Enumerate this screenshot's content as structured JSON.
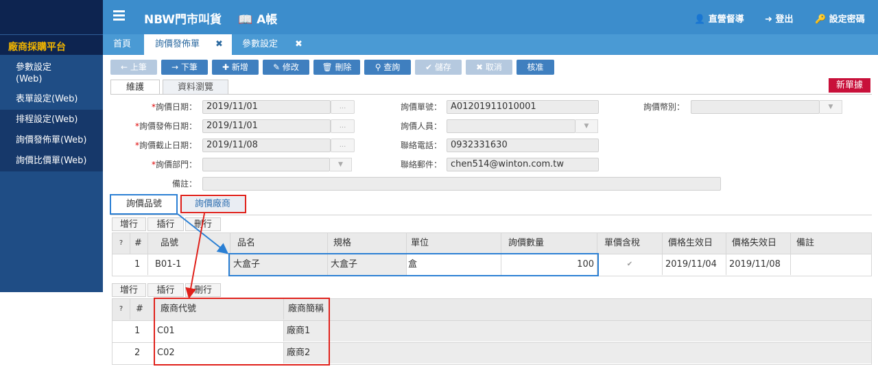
{
  "sidebar": {
    "brand": "廠商採購平台",
    "items": [
      {
        "label": "參數設定(Web)"
      },
      {
        "label": "表單設定(Web)"
      },
      {
        "label": "排程設定(Web)"
      },
      {
        "label": "詢價發佈單(Web)"
      },
      {
        "label": "詢價比價單(Web)"
      }
    ]
  },
  "header": {
    "app_title": "NBW門市叫貨",
    "account": "A帳",
    "supervisor": "直營督導",
    "logout": "登出",
    "set_password": "設定密碼"
  },
  "tabs": [
    {
      "label": "首頁"
    },
    {
      "label": "詢價發佈單",
      "close": "✖"
    },
    {
      "label": "參數設定",
      "close": "✖"
    }
  ],
  "toolbar": {
    "prev": "上筆",
    "next": "下筆",
    "add": "新增",
    "edit": "修改",
    "delete": "刪除",
    "query": "查詢",
    "save": "儲存",
    "cancel": "取消",
    "approve": "核准"
  },
  "subtabs": {
    "maintain": "維護",
    "browse": "資料瀏覽"
  },
  "new_doc": "新單據",
  "form": {
    "inquiry_date": {
      "label": "詢價日期：",
      "value": "2019/11/01"
    },
    "publish_date": {
      "label": "詢價發佈日期：",
      "value": "2019/11/01"
    },
    "deadline_date": {
      "label": "詢價截止日期：",
      "value": "2019/11/08"
    },
    "department": {
      "label": "詢價部門："
    },
    "remark": {
      "label": "備註："
    },
    "inquiry_no": {
      "label": "詢價單號：",
      "value": "A01201911010001"
    },
    "inquiry_person": {
      "label": "詢價人員："
    },
    "phone": {
      "label": "聯絡電話：",
      "value": "0932331630"
    },
    "email": {
      "label": "聯絡郵件：",
      "value": "chen514@winton.com.tw"
    },
    "currency": {
      "label": "詢價幣別："
    },
    "required_mark": "*",
    "dots": "...",
    "arrow": "▼"
  },
  "detail_tabs": {
    "items": "詢價品號",
    "vendors": "詢價廠商"
  },
  "grid_buttons": {
    "add_row": "增行",
    "insert_row": "插行",
    "delete_row": "刪行"
  },
  "items_grid": {
    "headers": {
      "help": "?",
      "num": "#",
      "item_no": "品號",
      "name": "品名",
      "spec": "規格",
      "unit": "單位",
      "qty": "詢價數量",
      "tax": "單價含稅",
      "eff": "價格生效日",
      "exp": "價格失效日",
      "remark": "備註"
    },
    "rows": [
      {
        "num": "1",
        "item_no": "B01-1",
        "name": "大盒子",
        "spec": "大盒子",
        "unit": "盒",
        "qty": "100",
        "tax": "✔",
        "eff": "2019/11/04",
        "exp": "2019/11/08",
        "remark": ""
      }
    ]
  },
  "vendor_grid": {
    "headers": {
      "help": "?",
      "num": "#",
      "code": "廠商代號",
      "short": "廠商簡稱"
    },
    "rows": [
      {
        "num": "1",
        "code": "C01",
        "short": "廠商1"
      },
      {
        "num": "2",
        "code": "C02",
        "short": "廠商2"
      }
    ]
  }
}
